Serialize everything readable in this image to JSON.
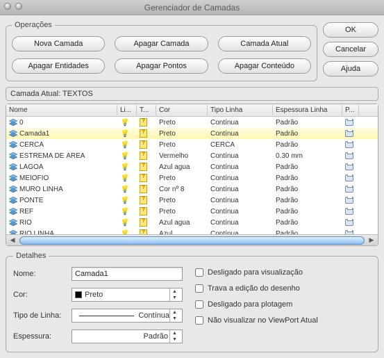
{
  "window": {
    "title": "Gerenciador de Camadas"
  },
  "operations": {
    "legend": "Operações",
    "nova": "Nova Camada",
    "apagar_camada": "Apagar Camada",
    "camada_atual": "Camada Atual",
    "apagar_entidades": "Apagar Entidades",
    "apagar_pontos": "Apagar Pontos",
    "apagar_conteudo": "Apagar Conteúdo"
  },
  "side": {
    "ok": "OK",
    "cancelar": "Cancelar",
    "ajuda": "Ajuda"
  },
  "current": {
    "label": "Camada Atual:",
    "value": "TEXTOS"
  },
  "columns": {
    "nome": "Nome",
    "li": "Li...",
    "t": "T...",
    "cor": "Cor",
    "tipo": "Tipo Linha",
    "esp": "Espessura Linha",
    "p": "P..."
  },
  "rows": [
    {
      "name": "0",
      "cor": "Preto",
      "tipo": "Contínua",
      "esp": "Padrão",
      "sel": false
    },
    {
      "name": "Camada1",
      "cor": "Preto",
      "tipo": "Contínua",
      "esp": "Padrão",
      "sel": true
    },
    {
      "name": "CERCA",
      "cor": "Preto",
      "tipo": "CERCA",
      "esp": "Padrão",
      "sel": false
    },
    {
      "name": "ESTREMA DE ÁREA",
      "cor": "Vermelho",
      "tipo": "Contínua",
      "esp": "0.30 mm",
      "sel": false
    },
    {
      "name": "LAGOA",
      "cor": "Azul agua",
      "tipo": "Contínua",
      "esp": "Padrão",
      "sel": false
    },
    {
      "name": "MEIOFIO",
      "cor": "Preto",
      "tipo": "Contínua",
      "esp": "Padrão",
      "sel": false
    },
    {
      "name": "MURO LINHA",
      "cor": "Cor nº 8",
      "tipo": "Contínua",
      "esp": "Padrão",
      "sel": false
    },
    {
      "name": "PONTE",
      "cor": "Preto",
      "tipo": "Contínua",
      "esp": "Padrão",
      "sel": false
    },
    {
      "name": "REF",
      "cor": "Preto",
      "tipo": "Contínua",
      "esp": "Padrão",
      "sel": false
    },
    {
      "name": "RIO",
      "cor": "Azul agua",
      "tipo": "Contínua",
      "esp": "Padrão",
      "sel": false
    },
    {
      "name": "RIO LINHA",
      "cor": "Azul",
      "tipo": "Contínua",
      "esp": "Padrão",
      "sel": false
    }
  ],
  "details": {
    "legend": "Detalhes",
    "nome_label": "Nome:",
    "nome_value": "Camada1",
    "cor_label": "Cor:",
    "cor_value": "Preto",
    "cor_swatch": "#000000",
    "tipo_label": "Tipo de Linha:",
    "tipo_value": "Contínua",
    "esp_label": "Espessura:",
    "esp_value": "Padrão"
  },
  "checks": {
    "desl_vis": "Desligado para visualização",
    "trava": "Trava a edição do desenho",
    "desl_plot": "Desligado para plotagem",
    "nao_vis": "Não visualizar no ViewPort Atual"
  }
}
